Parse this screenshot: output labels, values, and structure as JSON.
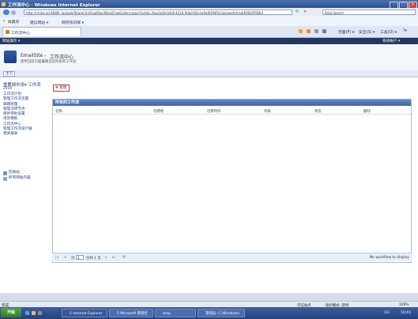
{
  "window": {
    "title": "工作流中心 - Windows Internet Explorer",
    "address": "http://ch-be-ad 8080/_layouts/ShareCityFlowMan/WorkFlowGallery.aspx?ListId=%ee3e0d-bfc8-4210-9da0-82cea9af0298%Closewuthtrip&RABOFRDEX",
    "search_placeholder": "Bing Search"
  },
  "favorites": {
    "label": "收藏夹",
    "items": [
      "建议网站 ▾",
      "网页快讯库 ▾"
    ]
  },
  "tab": {
    "label": "工作流中心"
  },
  "command_bar": {
    "items": [
      "页面(P) ▾",
      "安全(S) ▾",
      "工具(O) ▾",
      "?▾"
    ]
  },
  "site": {
    "actions_label": "网站操作 ▾",
    "user_label": "系统帐户 ▾",
    "breadcrumb_site": "EmailSite",
    "breadcrumb_sep": "›",
    "breadcrumb_page": "工作流中心",
    "description": "使用当前页面编辑当前列表的工作流",
    "home_tab": "主页"
  },
  "leftnav": {
    "title": "重要城市说▾ 工作流",
    "subtitle": "2010",
    "items": [
      "工作流计划",
      "管理工作流流量",
      "邮箱管理",
      "管理流转节点",
      "邮件审批设置",
      "消息模板",
      "工作流中心",
      "管理工作流设计器",
      "相关报表"
    ],
    "footer": [
      "回收站",
      "所有网站内容"
    ]
  },
  "toolbar": {
    "new_button": "新建"
  },
  "list": {
    "title": "所有的工作流",
    "columns": [
      "名称",
      "创建者",
      "创建时间",
      "列表",
      "状态",
      "删除"
    ],
    "pager_page_label": "页",
    "pager_page_value": "1",
    "pager_total": "页共 1 页",
    "empty_text": "No workflow to display"
  },
  "status": {
    "left": "完成",
    "zone": "可信站点",
    "protected_mode": "保护模式: 禁用",
    "zoom": "100%"
  },
  "taskbar": {
    "start_label": "开始",
    "tasks": [
      "5 Internet Explorer",
      "5 Microsoft 管理控",
      "drop",
      "管理员: C:\\Windows\\"
    ],
    "clock": "10:01",
    "lang": "CH"
  },
  "colors": {
    "brand": "#233860",
    "link": "#1c3f80",
    "panel_header": "#3e65a8",
    "highlight_border": "#d53a2a"
  }
}
